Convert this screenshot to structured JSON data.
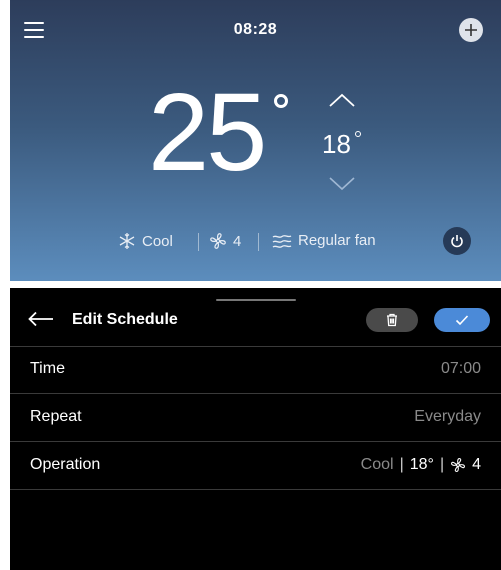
{
  "top": {
    "clock": "08:28",
    "current_temp": "25",
    "set_temp": "18",
    "status": {
      "mode_icon": "snowflake-icon",
      "mode": "Cool",
      "fan_icon": "fan-icon",
      "fan_speed": "4",
      "airflow_icon": "airflow-icon",
      "airflow": "Regular fan"
    }
  },
  "schedule": {
    "title": "Edit Schedule",
    "rows": [
      {
        "label": "Time",
        "value": "07:00"
      },
      {
        "label": "Repeat",
        "value": "Everyday"
      },
      {
        "label": "Operation",
        "mode": "Cool",
        "temp": "18°",
        "fan": "4"
      }
    ]
  },
  "colors": {
    "accent_blue": "#4b8ad8",
    "panel_top": "#2d3d5b",
    "panel_bottom": "#5c8dbd"
  }
}
